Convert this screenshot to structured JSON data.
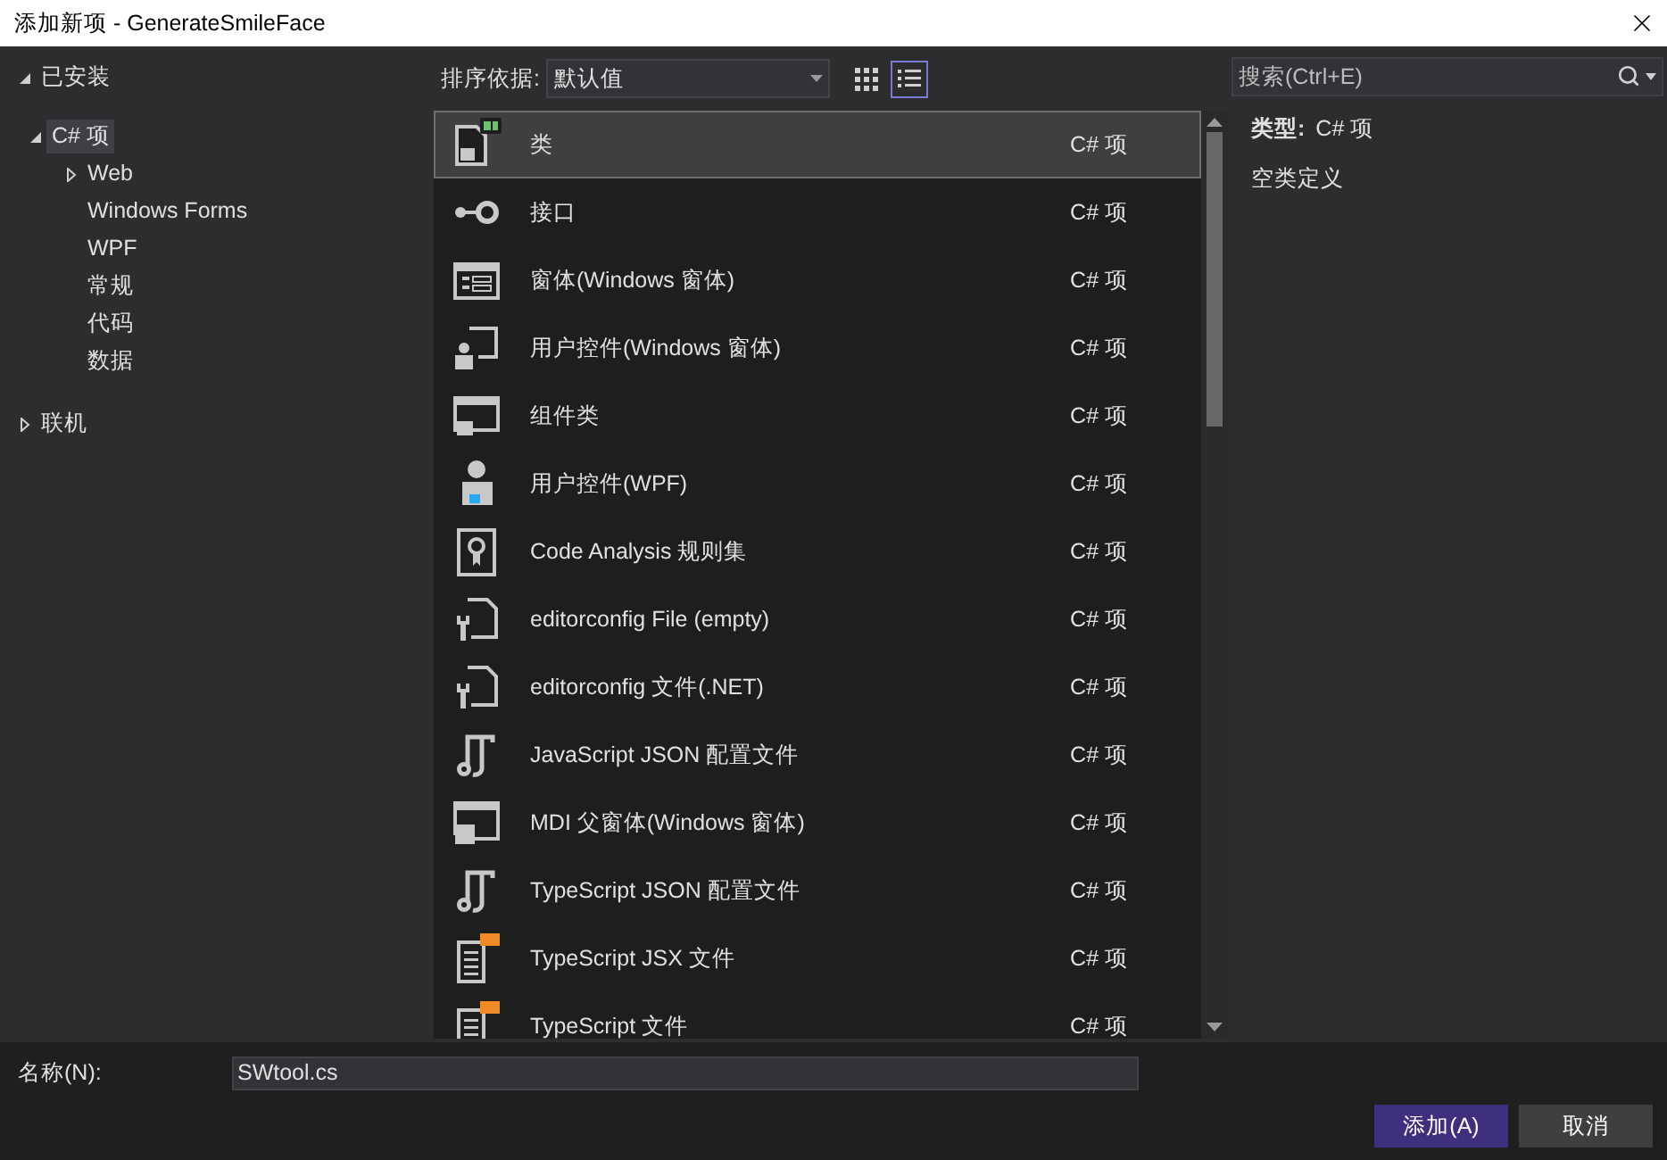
{
  "window": {
    "title": "添加新项 - GenerateSmileFace"
  },
  "tree": [
    {
      "label": "已安装",
      "expanded": true,
      "selected": false,
      "children": [
        {
          "label": "C# 项",
          "expanded": true,
          "selected": true,
          "children": [
            {
              "label": "Web",
              "expanded": false,
              "selected": false
            },
            {
              "label": "Windows Forms",
              "selected": false
            },
            {
              "label": "WPF",
              "selected": false
            },
            {
              "label": "常规",
              "selected": false
            },
            {
              "label": "代码",
              "selected": false
            },
            {
              "label": "数据",
              "selected": false
            }
          ]
        }
      ]
    },
    {
      "label": "联机",
      "expanded": false,
      "selected": false
    }
  ],
  "sort": {
    "label": "排序依据:",
    "value": "默认值"
  },
  "views": [
    {
      "kind": "grid",
      "selected": false
    },
    {
      "kind": "list",
      "selected": true
    }
  ],
  "search": {
    "placeholder": "搜索(Ctrl+E)"
  },
  "items": [
    {
      "kind": "class",
      "name": "类",
      "type": "C# 项",
      "selected": true
    },
    {
      "kind": "interface",
      "name": "接口",
      "type": "C# 项",
      "selected": false
    },
    {
      "kind": "form",
      "name": "窗体(Windows 窗体)",
      "type": "C# 项",
      "selected": false
    },
    {
      "kind": "usercontrol",
      "name": "用户控件(Windows 窗体)",
      "type": "C# 项",
      "selected": false
    },
    {
      "kind": "component",
      "name": "组件类",
      "type": "C# 项",
      "selected": false
    },
    {
      "kind": "wpf",
      "name": "用户控件(WPF)",
      "type": "C# 项",
      "selected": false
    },
    {
      "kind": "ruleset",
      "name": "Code Analysis 规则集",
      "type": "C# 项",
      "selected": false
    },
    {
      "kind": "editorconfig",
      "name": "editorconfig File (empty)",
      "type": "C# 项",
      "selected": false
    },
    {
      "kind": "editorconfig",
      "name": "editorconfig 文件(.NET)",
      "type": "C# 项",
      "selected": false
    },
    {
      "kind": "json",
      "name": "JavaScript JSON 配置文件",
      "type": "C# 项",
      "selected": false
    },
    {
      "kind": "mdi",
      "name": "MDI 父窗体(Windows 窗体)",
      "type": "C# 项",
      "selected": false
    },
    {
      "kind": "json",
      "name": "TypeScript JSON 配置文件",
      "type": "C# 项",
      "selected": false
    },
    {
      "kind": "ts",
      "name": "TypeScript JSX 文件",
      "type": "C# 项",
      "selected": false
    },
    {
      "kind": "ts",
      "name": "TypeScript 文件",
      "type": "C# 项",
      "selected": false
    }
  ],
  "details": {
    "type_label": "类型:",
    "type_value": "C# 项",
    "description": "空类定义"
  },
  "name_field": {
    "label": "名称(N):",
    "value": "SWtool.cs"
  },
  "buttons": [
    {
      "label": "添加(A)",
      "kind": "primary"
    },
    {
      "label": "取消",
      "kind": "secondary"
    }
  ]
}
